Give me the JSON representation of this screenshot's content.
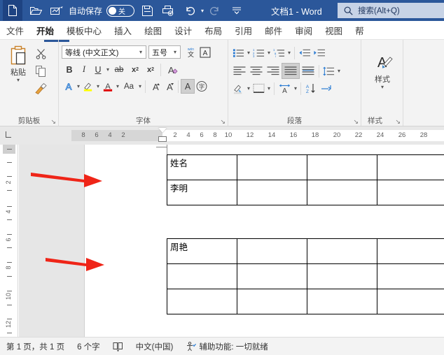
{
  "titlebar": {
    "icons": [
      {
        "name": "new-document-icon",
        "glyph": "doc"
      },
      {
        "name": "open-folder-icon",
        "glyph": "folder"
      },
      {
        "name": "touch-pen-icon",
        "glyph": "pen"
      }
    ],
    "autosave_label": "自动保存",
    "autosave_state": "关",
    "save_icon_name": "save-icon",
    "print-preview_icon_name": "quick-print-icon",
    "undo_label": "撤销",
    "redo_label": "恢复",
    "customize_label": "自定义快速访问工具栏",
    "document_title": "文档1  -  Word",
    "search_placeholder": "搜索(Alt+Q)"
  },
  "tabs": [
    {
      "label": "文件",
      "active": false
    },
    {
      "label": "开始",
      "active": true
    },
    {
      "label": "模板中心",
      "active": false
    },
    {
      "label": "插入",
      "active": false
    },
    {
      "label": "绘图",
      "active": false
    },
    {
      "label": "设计",
      "active": false
    },
    {
      "label": "布局",
      "active": false
    },
    {
      "label": "引用",
      "active": false
    },
    {
      "label": "邮件",
      "active": false
    },
    {
      "label": "审阅",
      "active": false
    },
    {
      "label": "视图",
      "active": false
    },
    {
      "label": "帮",
      "active": false
    }
  ],
  "ribbon": {
    "clipboard": {
      "group_label": "剪贴板",
      "paste_label": "粘贴",
      "cut_label": "剪切",
      "copy_label": "复制",
      "format_painter_label": "格式刷",
      "launcher": "↘"
    },
    "font": {
      "group_label": "字体",
      "font_name": "等线 (中文正文)",
      "font_size": "五号",
      "phonetic_label": "拼音指南",
      "char_border_label": "字符边框",
      "bold": "B",
      "italic": "I",
      "underline": "U",
      "strikethrough": "ab",
      "subscript": "x",
      "superscript": "x",
      "clear_format_label": "清除所有格式",
      "text_effects_label": "文本效果和版式",
      "highlight_label": "以不同颜色突出显示文本",
      "font_color_label": "字体颜色",
      "change_case_label": "Aa",
      "grow_font_label": "增大字号",
      "shrink_font_label": "减小字号",
      "shading_label": "A",
      "enclose_char_label": "带圈字符",
      "launcher": "↘"
    },
    "paragraph": {
      "group_label": "段落",
      "bullets_label": "项目符号",
      "numbering_label": "编号",
      "multilevel_label": "多级列表",
      "decrease_indent_label": "减少缩进量",
      "increase_indent_label": "增加缩进量",
      "align_left_label": "左对齐",
      "align_center_label": "居中",
      "align_right_label": "右对齐",
      "align_justify_label": "两端对齐",
      "distribute_label": "分散对齐",
      "line_spacing_label": "行和段落间距",
      "shading_label": "底纹",
      "borders_label": "边框",
      "ch_alignment_label": "中文版式",
      "sort_label": "排序",
      "show_marks_label": "显示编辑标记",
      "launcher": "↘"
    },
    "styles": {
      "group_label": "样式",
      "button_label": "样式",
      "launcher": "↘"
    }
  },
  "ruler": {
    "horizontal_numbers": [
      "8",
      "6",
      "4",
      "2",
      "2",
      "4",
      "6",
      "8",
      "10",
      "12",
      "14",
      "16",
      "18",
      "20",
      "22",
      "24",
      "26",
      "28"
    ],
    "vertical_numbers": [
      "2",
      "4",
      "6",
      "8",
      "10",
      "12"
    ]
  },
  "document": {
    "tables": [
      {
        "id": "table-1",
        "rows": [
          [
            "姓名",
            "",
            "",
            "",
            ""
          ],
          [
            "李明",
            "",
            "",
            "",
            ""
          ]
        ]
      },
      {
        "id": "table-2",
        "rows": [
          [
            "周艳",
            "",
            "",
            "",
            ""
          ],
          [
            "",
            "",
            "",
            "",
            ""
          ],
          [
            "",
            "",
            "",
            "",
            ""
          ]
        ]
      }
    ],
    "annotations": [
      {
        "name": "red-arrow-annotation-1",
        "color": "#ef2518"
      },
      {
        "name": "red-arrow-annotation-2",
        "color": "#ef2518"
      }
    ]
  },
  "statusbar": {
    "page_info": "第 1 页，共 1 页",
    "word_count": "6 个字",
    "proofing_icon_name": "proofing-icon",
    "language": "中文(中国)",
    "accessibility_icon_name": "accessibility-icon",
    "accessibility": "辅助功能: 一切就绪"
  },
  "colors": {
    "titlebar": "#2b579a",
    "accent": "#2b579a",
    "annotation_red": "#ef2518",
    "ribbon_bg": "#f3f3f3"
  }
}
